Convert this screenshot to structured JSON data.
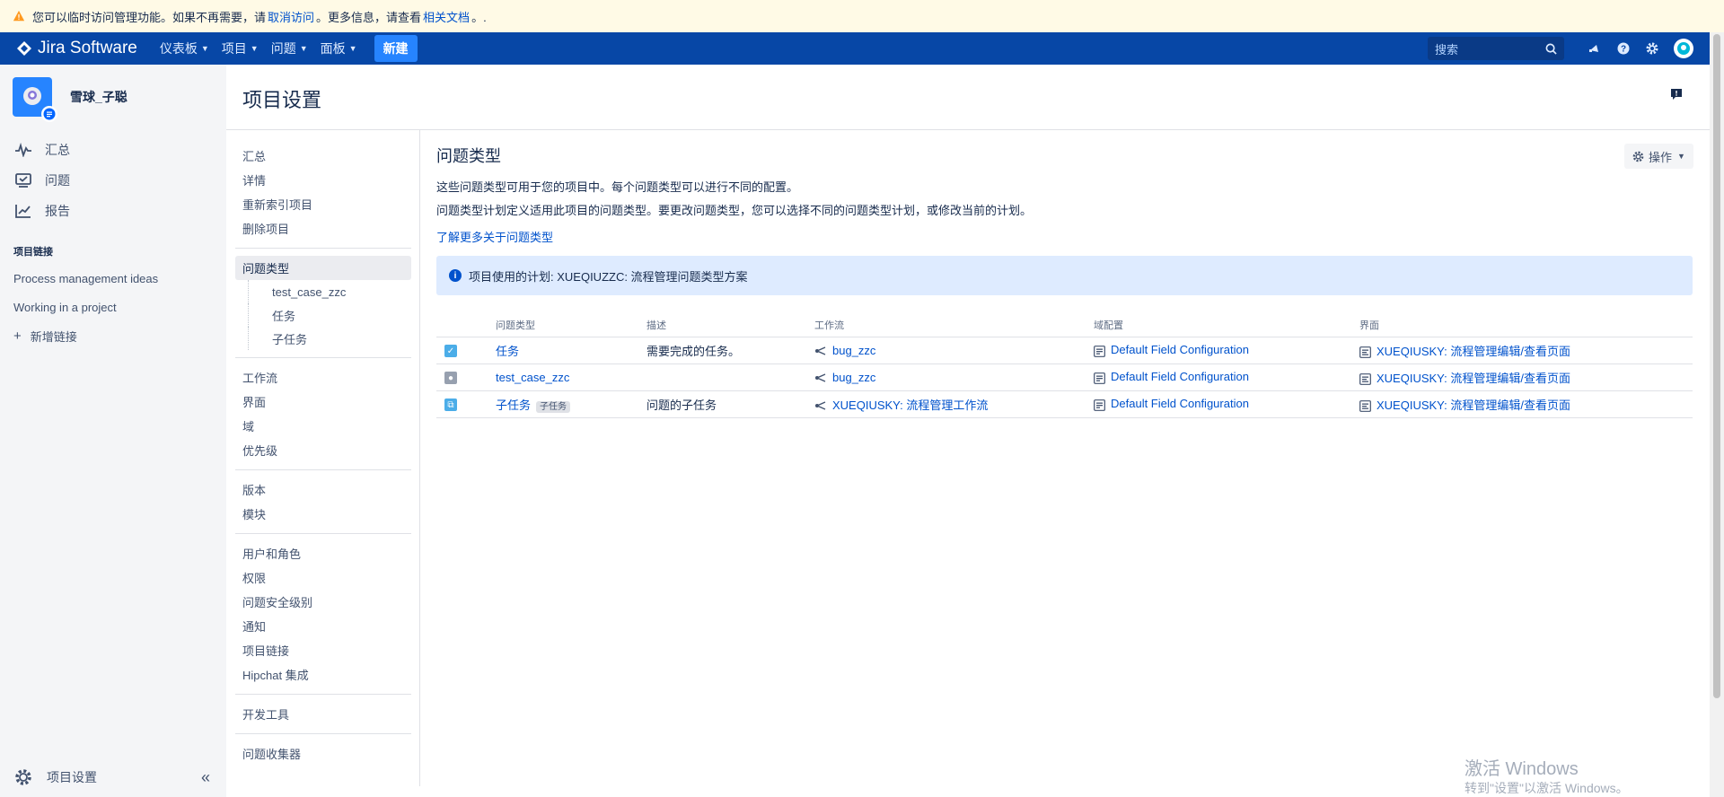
{
  "banner": {
    "text_before": "您可以临时访问管理功能。如果不再需要，请",
    "link1": "取消访问",
    "text_mid": "。更多信息，请查看",
    "link2": "相关文档",
    "text_after": "。."
  },
  "topnav": {
    "logo_text": "Jira Software",
    "menu": [
      "仪表板",
      "项目",
      "问题",
      "面板"
    ],
    "create_label": "新建",
    "search_placeholder": "搜索"
  },
  "sidebar": {
    "project_name": "雪球_子聪",
    "nav": [
      "汇总",
      "问题",
      "报告"
    ],
    "links_heading": "项目链接",
    "links": [
      "Process management ideas",
      "Working in a project"
    ],
    "add_link": "新增链接",
    "bottom_label": "项目设置"
  },
  "page_title": "项目设置",
  "settings_nav": {
    "group1": [
      "汇总",
      "详情",
      "重新索引项目",
      "删除项目"
    ],
    "active": "问题类型",
    "sub": [
      "test_case_zzc",
      "任务",
      "子任务"
    ],
    "group2": [
      "工作流",
      "界面",
      "域",
      "优先级"
    ],
    "group3": [
      "版本",
      "模块"
    ],
    "group4": [
      "用户和角色",
      "权限",
      "问题安全级别",
      "通知",
      "项目链接",
      "Hipchat 集成"
    ],
    "group5": [
      "开发工具"
    ],
    "group6": [
      "问题收集器"
    ]
  },
  "main": {
    "title": "问题类型",
    "actions_label": "操作",
    "desc1": "这些问题类型可用于您的项目中。每个问题类型可以进行不同的配置。",
    "desc2": "问题类型计划定义适用此项目的问题类型。要更改问题类型，您可以选择不同的问题类型计划，或修改当前的计划。",
    "learn_more": "了解更多关于问题类型",
    "scheme_text": "项目使用的计划: XUEQIUZZC: 流程管理问题类型方案",
    "columns": [
      "问题类型",
      "描述",
      "工作流",
      "域配置",
      "界面"
    ],
    "rows": [
      {
        "type": "任务",
        "tag": "",
        "desc": "需要完成的任务。",
        "workflow": "bug_zzc",
        "field_config": "Default Field Configuration",
        "screen": "XUEQIUSKY: 流程管理编辑/查看页面",
        "icon_color": "#4bade8"
      },
      {
        "type": "test_case_zzc",
        "tag": "",
        "desc": "",
        "workflow": "bug_zzc",
        "field_config": "Default Field Configuration",
        "screen": "XUEQIUSKY: 流程管理编辑/查看页面",
        "icon_color": "#97a0af"
      },
      {
        "type": "子任务",
        "tag": "子任务",
        "desc": "问题的子任务",
        "workflow": "XUEQIUSKY: 流程管理工作流",
        "field_config": "Default Field Configuration",
        "screen": "XUEQIUSKY: 流程管理编辑/查看页面",
        "icon_color": "#4bade8"
      }
    ]
  },
  "watermark": {
    "line1": "激活 Windows",
    "line2": "转到\"设置\"以激活 Windows。"
  }
}
